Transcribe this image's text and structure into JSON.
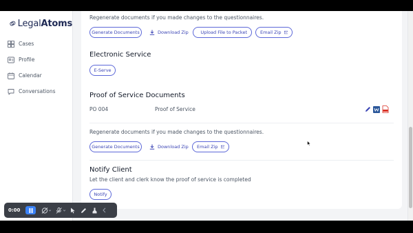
{
  "brand": {
    "name_light": "Legal",
    "name_bold": "Atoms",
    "color": "#1f2a55"
  },
  "sidebar": {
    "items": [
      {
        "label": "Cases",
        "icon": "cases-icon"
      },
      {
        "label": "Profile",
        "icon": "profile-icon"
      },
      {
        "label": "Calendar",
        "icon": "calendar-icon"
      },
      {
        "label": "Conversations",
        "icon": "conversations-icon"
      }
    ]
  },
  "top_section": {
    "hint": "Regenerate documents if you made changes to the questionnaires.",
    "generate_label": "Generate Documents",
    "download_label": "Download Zip",
    "upload_label": "Upload File to Packet",
    "email_label": "Email Zip"
  },
  "electronic_service": {
    "title": "Electronic Service",
    "eserve_label": "E-Serve"
  },
  "proof_of_service": {
    "title": "Proof of Service Documents",
    "row": {
      "code": "PO 004",
      "name": "Proof of Service"
    },
    "hint": "Regenerate documents if you made changes to the questionnaires.",
    "generate_label": "Generate Documents",
    "download_label": "Download Zip",
    "email_label": "Email Zip"
  },
  "notify_client": {
    "title": "Notify Client",
    "description": "Let the client and clerk know the proof of service is completed",
    "notify_label": "Notify"
  },
  "recorder": {
    "time": "0:00"
  },
  "colors": {
    "accent": "#3b45b5",
    "accent_border": "#5b67d8",
    "word_blue": "#2b579a",
    "pdf_red": "#d93025",
    "recorder_bg": "#3b3f47",
    "pause_blue": "#3b82f6"
  }
}
